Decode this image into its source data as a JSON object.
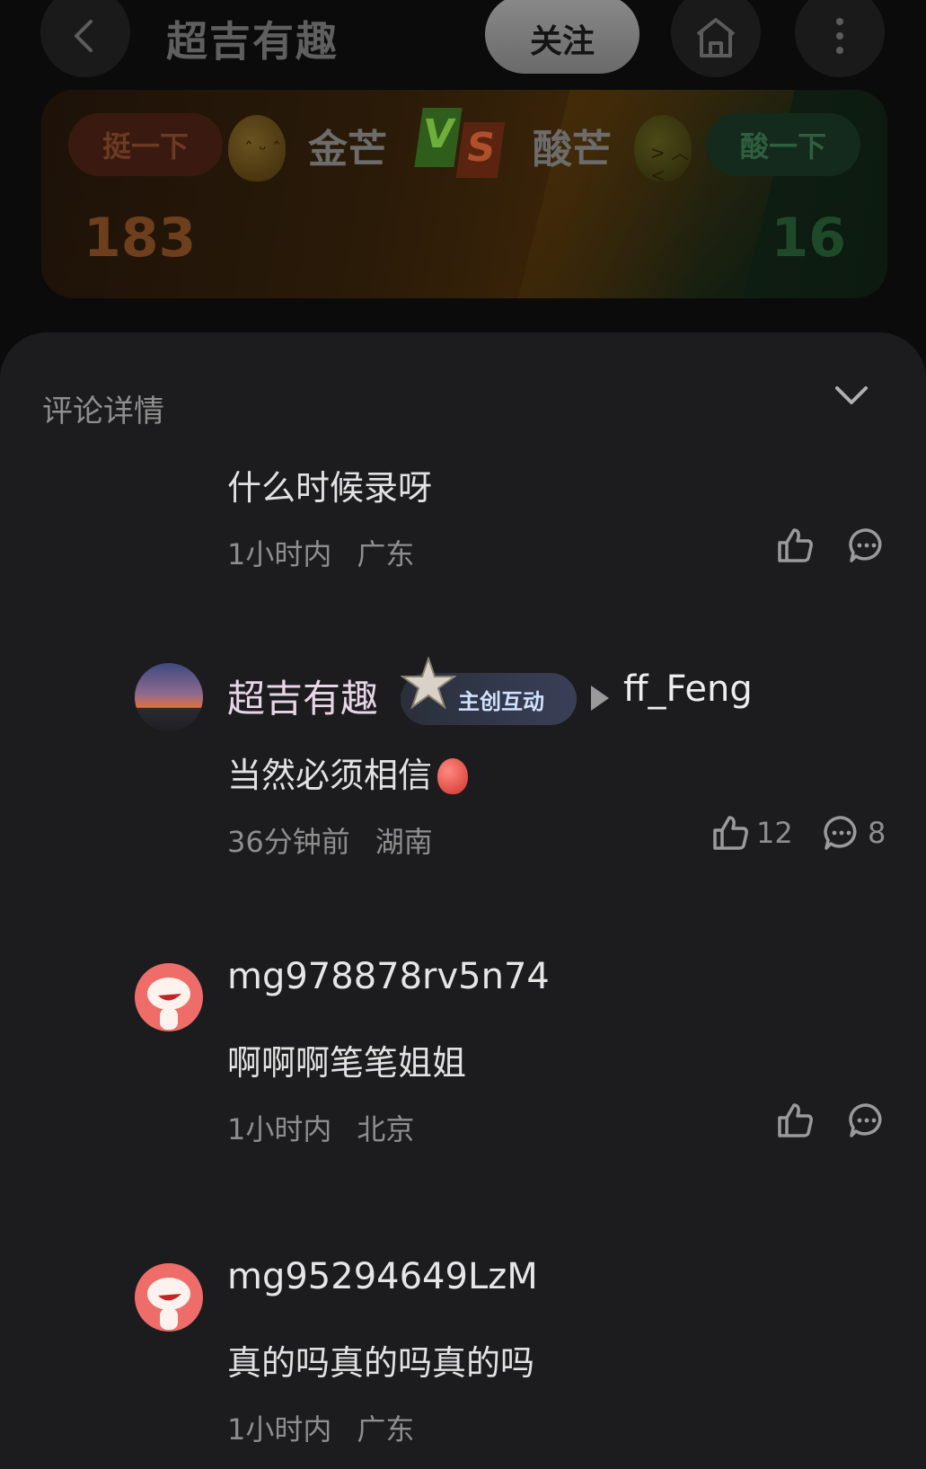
{
  "header": {
    "title": "超吉有趣",
    "follow_label": "关注",
    "back_icon": "back-arrow-icon",
    "home_icon": "home-icon",
    "more_icon": "more-vertical-icon"
  },
  "vs": {
    "left": {
      "vote_label": "挺一下",
      "name": "金芒",
      "count": "183"
    },
    "right": {
      "vote_label": "酸一下",
      "name": "酸芒",
      "count": "16"
    },
    "logo": {
      "v": "V",
      "s": "S"
    }
  },
  "comments_panel": {
    "title": "评论详情",
    "collapse_icon": "chevron-down-icon",
    "comments": [
      {
        "content": "什么时候录呀",
        "time": "1小时内",
        "location": "广东"
      },
      {
        "username": "超吉有趣",
        "badge": "主创互动",
        "reply_to": "ff_Feng",
        "content": "当然必须相信",
        "time": "36分钟前",
        "location": "湖南",
        "likes": "12",
        "replies": "8"
      },
      {
        "username": "mg978878rv5n74",
        "content": "啊啊啊笔笔姐姐",
        "time": "1小时内",
        "location": "北京"
      },
      {
        "username": "mg95294649LzM",
        "content": "真的吗真的吗真的吗",
        "time": "1小时内",
        "location": "广东"
      }
    ]
  },
  "colors": {
    "background": "#0b0b0b",
    "sheet": "#1c1c1e",
    "muted_text": "#8e8e8e",
    "left_team": "#6d3f1c",
    "right_team": "#1f4a2a"
  }
}
